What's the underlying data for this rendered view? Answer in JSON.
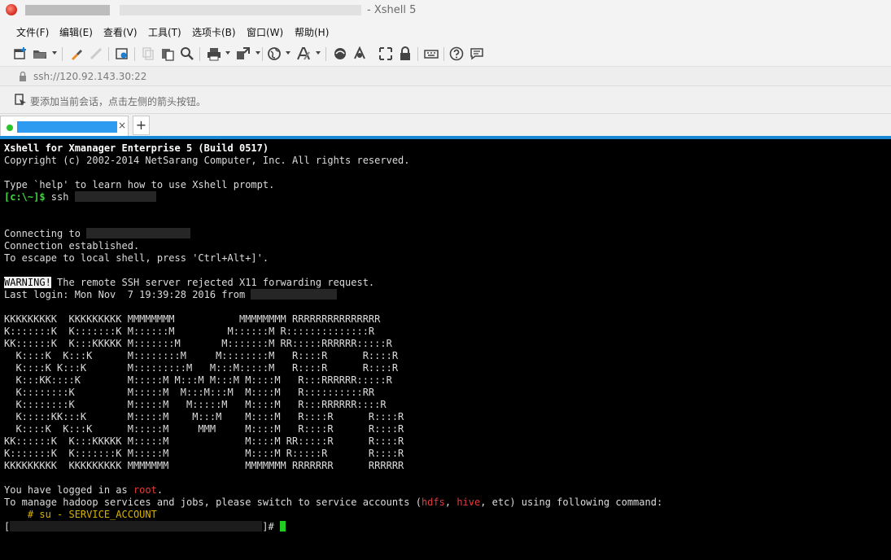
{
  "window": {
    "title_suffix": "- Xshell 5"
  },
  "menu": [
    "文件(F)",
    "编辑(E)",
    "查看(V)",
    "工具(T)",
    "选项卡(B)",
    "窗口(W)",
    "帮助(H)"
  ],
  "toolbar_icons": [
    "new-session-icon",
    "open-folder-icon",
    "reconnect-icon",
    "disconnect-icon",
    "properties-icon",
    "copy-icon",
    "paste-icon",
    "find-icon",
    "print-icon",
    "transfer-icon",
    "globe-icon",
    "font-icon",
    "xftp-icon",
    "xmanager-icon",
    "lock-icon",
    "fullscreen-icon",
    "transparency-icon",
    "keyboard-icon",
    "help-icon",
    "chat-icon"
  ],
  "address": {
    "url": "ssh://120.92.143.30:22"
  },
  "session_hint": "要添加当前会话，点击左侧的箭头按钮。",
  "tab": {
    "close": "×",
    "add": "+"
  },
  "terminal": {
    "banner_line1": "Xshell for Xmanager Enterprise 5 (Build 0517)",
    "banner_line2": "Copyright (c) 2002-2014 NetSarang Computer, Inc. All rights reserved.",
    "help_line": "Type `help' to learn how to use Xshell prompt.",
    "local_prompt": "[c:\\~]$",
    "ssh_cmd": " ssh ",
    "connecting": "Connecting to ",
    "established": "Connection established.",
    "escape": "To escape to local shell, press 'Ctrl+Alt+]'.",
    "warning_label": "WARNING!",
    "warning_text": " The remote SSH server rejected X11 forwarding request.",
    "last_login": "Last login: Mon Nov  7 19:39:28 2016 from ",
    "ascii_art": [
      "KKKKKKKKK  KKKKKKKKK MMMMMMMM           MMMMMMMM RRRRRRRRRRRRRRR",
      "K:::::::K  K:::::::K M::::::M         M::::::M R::::::::::::::R",
      "KK::::::K  K:::KKKKK M:::::::M       M:::::::M RR:::::RRRRRR:::::R",
      "  K::::K  K:::K      M::::::::M     M::::::::M   R::::R      R::::R",
      "  K::::K K:::K       M:::::::::M   M:::M:::::M   R::::R      R::::R",
      "  K:::KK::::K        M:::::M M:::M M:::M M::::M   R:::RRRRRR:::::R",
      "  K::::::::K         M:::::M  M:::M:::M  M::::M   R::::::::::RR",
      "  K::::::::K         M:::::M   M:::::M   M::::M   R:::RRRRRR::::R",
      "  K:::::KK:::K       M:::::M    M:::M    M::::M   R::::R      R::::R",
      "  K::::K  K:::K      M:::::M     MMM     M::::M   R::::R      R::::R",
      "KK::::::K  K:::KKKKK M:::::M             M::::M RR:::::R      R::::R",
      "K:::::::K  K:::::::K M:::::M             M::::M R:::::R       R::::R",
      "KKKKKKKKK  KKKKKKKKK MMMMMMM             MMMMMMM RRRRRRR      RRRRRR"
    ],
    "logged_in_prefix": "You have logged in as ",
    "logged_in_user": "root",
    "logged_in_suffix": ".",
    "manage_prefix": "To manage hadoop services and jobs, please switch to service accounts (",
    "acct1": "hdfs",
    "sep": ", ",
    "acct2": "hive",
    "manage_suffix": ", etc) using following command:",
    "su_cmd": "    # su - SERVICE_ACCOUNT",
    "prompt_open": "[",
    "prompt_close": "]#"
  }
}
